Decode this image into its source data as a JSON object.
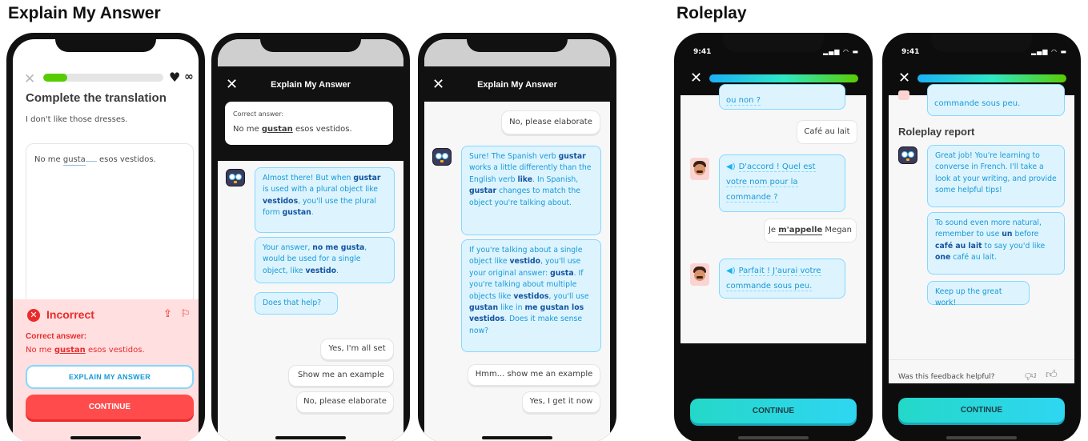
{
  "sections": {
    "explain": "Explain My Answer",
    "roleplay": "Roleplay"
  },
  "screen1": {
    "progress_fraction": 0.2,
    "hearts": "∞",
    "title": "Complete the translation",
    "prompt": "I don't like those dresses.",
    "answer_before": "No me",
    "answer_blank": "gusta",
    "answer_after": "esos vestidos.",
    "result_title": "Incorrect",
    "correct_label": "Correct answer:",
    "correct_before": "No me",
    "correct_key": "gustan",
    "correct_after": "esos vestidos.",
    "explain_button": "EXPLAIN MY ANSWER",
    "continue_button": "CONTINUE"
  },
  "screen2": {
    "sheet_title": "Explain My Answer",
    "card_label": "Correct answer:",
    "card_before": "No me",
    "card_key": "gustan",
    "card_after": "esos vestidos.",
    "bubble1": {
      "a": "Almost there! But when ",
      "b": "gustar",
      "c": " is used with a plural object like ",
      "d": "vestidos",
      "e": ", you'll use the plural form ",
      "f": "gustan",
      "g": "."
    },
    "bubble2": {
      "a": "Your answer, ",
      "b": "no me gusta",
      "c": ", would be used for a single object, like ",
      "d": "vestido",
      "e": "."
    },
    "bubble3": "Does that help?",
    "replies": [
      "Yes, I'm all set",
      "Show me an example",
      "No, please elaborate"
    ]
  },
  "screen3": {
    "sheet_title": "Explain My Answer",
    "user_reply": "No, please elaborate",
    "bubble1": {
      "a": "Sure! The Spanish verb ",
      "b": "gustar",
      "c": " works a little differently than the English verb ",
      "d": "like",
      "e": ". In Spanish, ",
      "f": "gustar",
      "g": " changes to match the object you're talking about."
    },
    "bubble2": {
      "a": "If you're talking about a single object like ",
      "b": "vestido",
      "c": ", you'll use your original answer: ",
      "d": "gusta",
      "e": ". If you're talking about multiple objects like ",
      "f": "vestidos",
      "g": ", you'll use ",
      "h": "gustan",
      "i": " like in ",
      "j": "me gustan los vestidos",
      "k": ". Does it make sense now?"
    },
    "replies": [
      "Hmm... show me an example",
      "Yes, I get it now"
    ]
  },
  "screen4": {
    "time": "9:41",
    "status_icons": "▂▄▆ ◠ ▬",
    "cut_bubble": "ou non ?",
    "user1": "Café au lait",
    "bot1": {
      "a": "D'accord ! Quel est",
      "b": "votre nom pour la",
      "c": "commande ?"
    },
    "user2": {
      "a": "Je ",
      "b": "m'appelle",
      "c": " Megan"
    },
    "bot2": {
      "a": "Parfait ! J'aurai votre",
      "b": "commande sous peu."
    },
    "continue_button": "CONTINUE"
  },
  "screen5": {
    "time": "9:41",
    "status_icons": "▂▄▆ ◠ ▬",
    "cut_bubble": "commande sous peu.",
    "report_title": "Roleplay report",
    "bubble1": "Great job! You're learning to converse in French. I'll take a look at your writing, and provide some helpful tips!",
    "bubble2": {
      "a": "To sound even more natural, remember to use ",
      "b": "un",
      "c": " before ",
      "d": "café au lait",
      "e": " to say you'd like ",
      "f": "one",
      "g": " café au lait."
    },
    "bubble3": "Keep up the great work!",
    "feedback_question": "Was this feedback helpful?",
    "continue_button": "CONTINUE"
  }
}
